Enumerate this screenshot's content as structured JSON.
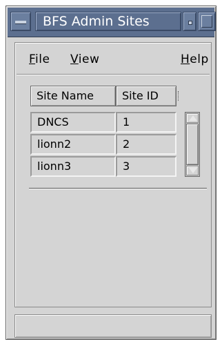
{
  "window": {
    "title": "BFS Admin Sites"
  },
  "menubar": {
    "file": {
      "accel": "F",
      "rest": "ile"
    },
    "view": {
      "accel": "V",
      "rest": "iew"
    },
    "help": {
      "accel": "H",
      "rest": "elp"
    }
  },
  "table": {
    "columns": [
      "Site Name",
      "Site ID"
    ],
    "rows": [
      {
        "name": "DNCS",
        "id": "1"
      },
      {
        "name": "lionn2",
        "id": "2"
      },
      {
        "name": "lionn3",
        "id": "3"
      }
    ]
  },
  "statusbar": {
    "text": ""
  },
  "colors": {
    "titlebar": "#5c6f8f",
    "window_bg": "#d4d4d4"
  }
}
